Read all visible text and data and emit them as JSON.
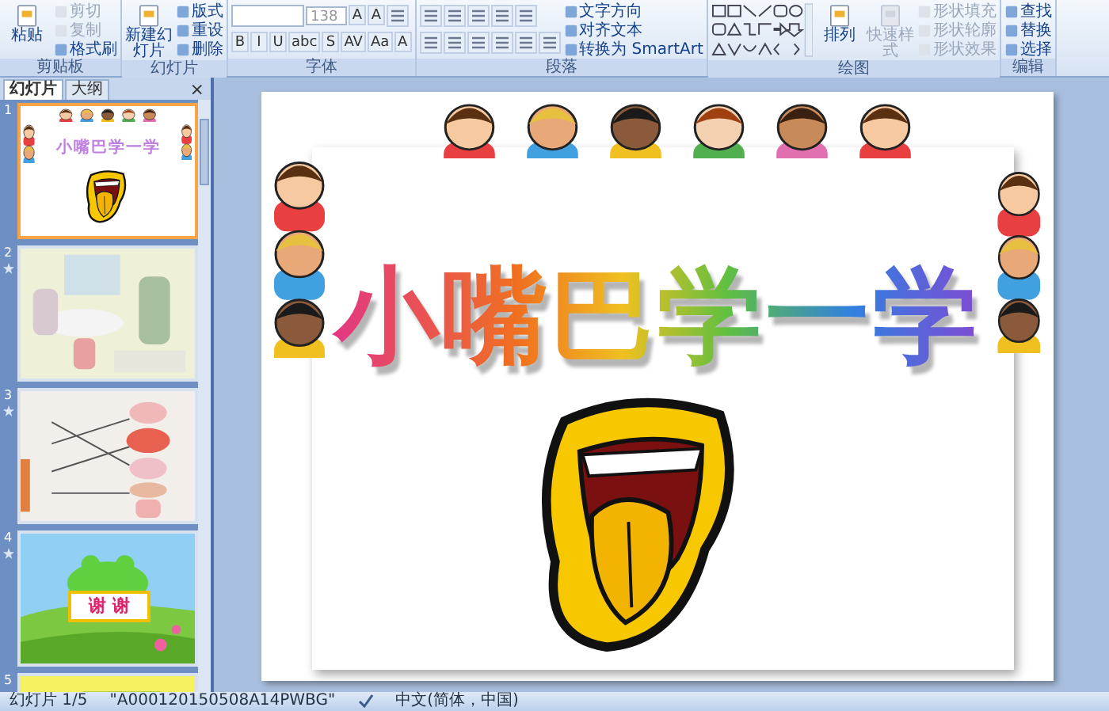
{
  "ribbon": {
    "groups": [
      {
        "label": "剪贴板",
        "columns": [
          [
            {
              "kind": "large",
              "label": "粘贴",
              "disabled": false
            }
          ],
          [
            {
              "kind": "small",
              "label": "剪切",
              "disabled": true
            },
            {
              "kind": "small",
              "label": "复制",
              "disabled": true
            },
            {
              "kind": "small",
              "label": "格式刷",
              "disabled": false
            }
          ]
        ]
      },
      {
        "label": "幻灯片",
        "columns": [
          [
            {
              "kind": "large",
              "label": "新建幻灯片",
              "disabled": false
            }
          ],
          [
            {
              "kind": "small",
              "label": "版式",
              "disabled": false
            },
            {
              "kind": "small",
              "label": "重设",
              "disabled": false
            },
            {
              "kind": "small",
              "label": "删除",
              "disabled": false
            }
          ]
        ]
      },
      {
        "label": "字体",
        "columns": [
          [
            {
              "kind": "row",
              "items": [
                {
                  "kind": "font-field"
                },
                {
                  "kind": "size-field",
                  "value": "138"
                },
                {
                  "kind": "glyph",
                  "text": "A"
                },
                {
                  "kind": "glyph",
                  "text": "A"
                },
                {
                  "kind": "icon"
                }
              ]
            },
            {
              "kind": "row",
              "items": [
                {
                  "kind": "glyph",
                  "text": "B"
                },
                {
                  "kind": "glyph",
                  "text": "I"
                },
                {
                  "kind": "glyph",
                  "text": "U"
                },
                {
                  "kind": "glyph",
                  "text": "abc"
                },
                {
                  "kind": "glyph",
                  "text": "S"
                },
                {
                  "kind": "glyph",
                  "text": "AV"
                },
                {
                  "kind": "glyph",
                  "text": "Aa"
                },
                {
                  "kind": "glyph",
                  "text": "A"
                }
              ]
            }
          ]
        ]
      },
      {
        "label": "段落",
        "columns": [
          [
            {
              "kind": "row",
              "items": [
                {
                  "kind": "icon"
                },
                {
                  "kind": "icon"
                },
                {
                  "kind": "icon"
                },
                {
                  "kind": "icon"
                },
                {
                  "kind": "icon"
                }
              ]
            },
            {
              "kind": "row",
              "items": [
                {
                  "kind": "icon"
                },
                {
                  "kind": "icon"
                },
                {
                  "kind": "icon"
                },
                {
                  "kind": "icon"
                },
                {
                  "kind": "icon"
                },
                {
                  "kind": "icon"
                }
              ]
            }
          ],
          [
            {
              "kind": "small",
              "label": "文字方向",
              "disabled": false
            },
            {
              "kind": "small",
              "label": "对齐文本",
              "disabled": false
            },
            {
              "kind": "small",
              "label": "转换为 SmartArt",
              "disabled": false
            }
          ]
        ]
      },
      {
        "label": "绘图",
        "columns": [
          [
            {
              "kind": "gallery"
            }
          ],
          [
            {
              "kind": "large",
              "label": "排列",
              "disabled": false
            }
          ],
          [
            {
              "kind": "large",
              "label": "快速样式",
              "disabled": true
            }
          ],
          [
            {
              "kind": "small",
              "label": "形状填充",
              "disabled": true
            },
            {
              "kind": "small",
              "label": "形状轮廓",
              "disabled": true
            },
            {
              "kind": "small",
              "label": "形状效果",
              "disabled": true
            }
          ]
        ]
      },
      {
        "label": "编辑",
        "columns": [
          [
            {
              "kind": "small",
              "label": "查找",
              "disabled": false
            },
            {
              "kind": "small",
              "label": "替换",
              "disabled": false
            },
            {
              "kind": "small",
              "label": "选择",
              "disabled": false
            }
          ]
        ]
      }
    ]
  },
  "pane": {
    "tabs": [
      {
        "label": "幻灯片",
        "selected": true
      },
      {
        "label": "大纲",
        "selected": false
      }
    ],
    "close": "×",
    "slides": [
      {
        "number": "1",
        "selected": true,
        "animated": false,
        "kind": "title",
        "title": "小嘴巴学一学"
      },
      {
        "number": "2",
        "selected": false,
        "animated": true,
        "kind": "picture"
      },
      {
        "number": "3",
        "selected": false,
        "animated": true,
        "kind": "picture"
      },
      {
        "number": "4",
        "selected": false,
        "animated": true,
        "kind": "sign",
        "text": "谢 谢"
      },
      {
        "number": "5",
        "selected": false,
        "animated": false,
        "kind": "picture"
      }
    ]
  },
  "slide": {
    "title": "小嘴巴学一学"
  },
  "status_bar": {
    "position": "幻灯片 1/5",
    "theme": "\"A000120150508A14PWBG\"",
    "language": "中文(简体，中国)"
  }
}
